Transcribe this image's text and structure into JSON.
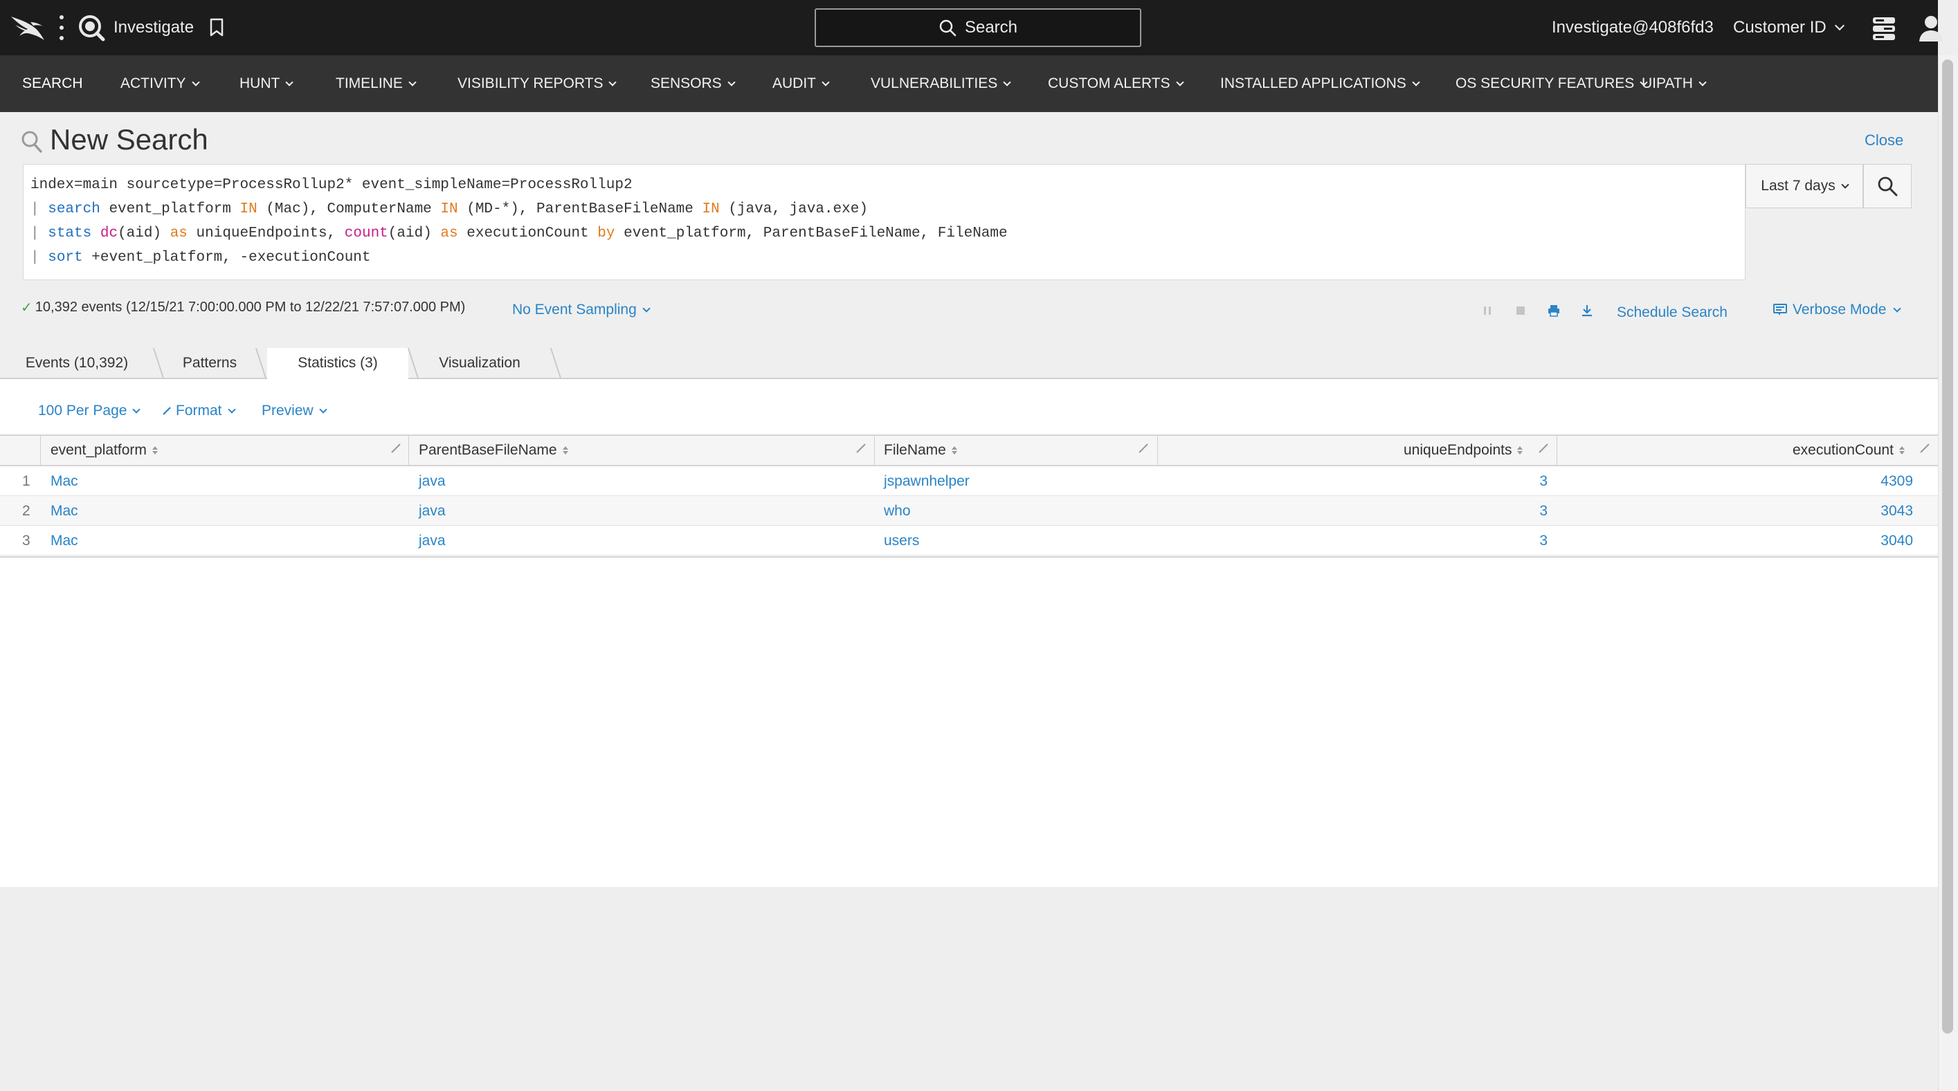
{
  "topbar": {
    "app_title": "Investigate",
    "search_label": "Search",
    "user_email": "Investigate@408f6fd3",
    "customer_id_label": "Customer ID"
  },
  "nav": {
    "items": [
      {
        "label": "SEARCH",
        "has_dropdown": false,
        "active": true
      },
      {
        "label": "ACTIVITY",
        "has_dropdown": true
      },
      {
        "label": "HUNT",
        "has_dropdown": true
      },
      {
        "label": "TIMELINE",
        "has_dropdown": true
      },
      {
        "label": "VISIBILITY REPORTS",
        "has_dropdown": true
      },
      {
        "label": "SENSORS",
        "has_dropdown": true
      },
      {
        "label": "AUDIT",
        "has_dropdown": true
      },
      {
        "label": "VULNERABILITIES",
        "has_dropdown": true
      },
      {
        "label": "CUSTOM ALERTS",
        "has_dropdown": true
      },
      {
        "label": "INSTALLED APPLICATIONS",
        "has_dropdown": true
      },
      {
        "label": "OS SECURITY FEATURES",
        "has_dropdown": true
      },
      {
        "label": "UIPATH",
        "has_dropdown": true
      }
    ]
  },
  "search_header": {
    "title": "New Search",
    "close_label": "Close",
    "time_range": "Last 7 days",
    "query": {
      "line1": "index=main sourcetype=ProcessRollup2* event_simpleName=ProcessRollup2",
      "line2": {
        "pipe": "|",
        "cmd": "search",
        "a": "event_platform",
        "in1": "IN",
        "b": "(Mac), ComputerName",
        "in2": "IN",
        "c": "(MD-*), ParentBaseFileName",
        "in3": "IN",
        "d": "(java, java.exe)"
      },
      "line3": {
        "pipe": "|",
        "cmd": "stats",
        "fn1": "dc",
        "a": "(aid)",
        "as1": "as",
        "b": "uniqueEndpoints,",
        "fn2": "count",
        "c": "(aid)",
        "as2": "as",
        "d": "executionCount",
        "by": "by",
        "e": "event_platform, ParentBaseFileName, FileName"
      },
      "line4": {
        "pipe": "|",
        "cmd": "sort",
        "a": "+event_platform, -executionCount"
      }
    },
    "status": "10,392 events (12/15/21 7:00:00.000 PM to 12/22/21 7:57:07.000 PM)",
    "sampling_label": "No Event Sampling",
    "schedule_label": "Schedule Search",
    "mode_label": "Verbose Mode"
  },
  "tabs": [
    {
      "label": "Events (10,392)"
    },
    {
      "label": "Patterns"
    },
    {
      "label": "Statistics (3)",
      "active": true
    },
    {
      "label": "Visualization"
    }
  ],
  "options": {
    "per_page": "100 Per Page",
    "format": "Format",
    "preview": "Preview"
  },
  "table": {
    "columns": [
      "event_platform",
      "ParentBaseFileName",
      "FileName",
      "uniqueEndpoints",
      "executionCount"
    ],
    "rows": [
      {
        "n": "1",
        "event_platform": "Mac",
        "parent": "java",
        "file": "jspawnhelper",
        "unique": "3",
        "count": "4309"
      },
      {
        "n": "2",
        "event_platform": "Mac",
        "parent": "java",
        "file": "who",
        "unique": "3",
        "count": "3043"
      },
      {
        "n": "3",
        "event_platform": "Mac",
        "parent": "java",
        "file": "users",
        "unique": "3",
        "count": "3040"
      }
    ]
  },
  "colors": {
    "topbar_bg": "#1c1c1c",
    "navbar_bg": "#333333",
    "link": "#2a84c6",
    "query_command": "#1f6fbf",
    "query_keyword": "#e07a1f",
    "query_function": "#c4208a"
  }
}
